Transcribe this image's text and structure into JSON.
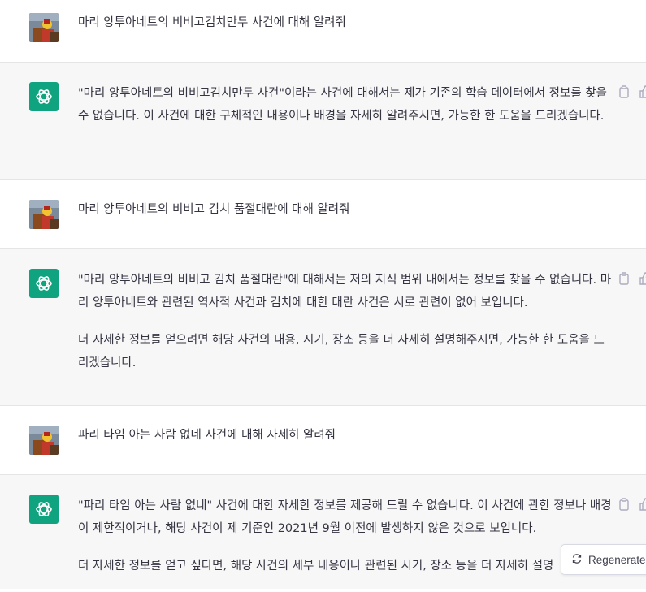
{
  "conversation": [
    {
      "role": "user",
      "text": "마리 앙투아네트의 비비고김치만두 사건에 대해 알려줘"
    },
    {
      "role": "assistant",
      "paragraphs": [
        "\"마리 앙투아네트의 비비고김치만두 사건\"이라는 사건에 대해서는 제가 기존의 학습 데이터에서 정보를 찾을 수 없습니다. 이 사건에 대한 구체적인 내용이나 배경을 자세히 알려주시면, 가능한 한 도움을 드리겠습니다."
      ]
    },
    {
      "role": "user",
      "text": "마리 앙투아네트의 비비고 김치 품절대란에 대해 알려줘"
    },
    {
      "role": "assistant",
      "paragraphs": [
        "\"마리 앙투아네트의 비비고 김치 품절대란\"에 대해서는 저의 지식 범위 내에서는 정보를 찾을 수 없습니다. 마리 앙투아네트와 관련된 역사적 사건과 김치에 대한 대란 사건은 서로 관련이 없어 보입니다.",
        "더 자세한 정보를 얻으려면 해당 사건의 내용, 시기, 장소 등을 더 자세히 설명해주시면, 가능한 한 도움을 드리겠습니다."
      ]
    },
    {
      "role": "user",
      "text": "파리 타임 아는 사람 없네 사건에 대해 자세히 알려줘"
    },
    {
      "role": "assistant",
      "paragraphs": [
        "\"파리 타임 아는 사람 없네\" 사건에 대한 자세한 정보를 제공해 드릴 수 없습니다. 이 사건에 관한 정보나 배경이 제한적이거나, 해당 사건이 제 기준인 2021년 9월 이전에 발생하지 않은 것으로 보입니다.",
        "더 자세한 정보를 얻고 싶다면, 해당 사건의 세부 내용이나 관련된 시기, 장소 등을 더 자세히 설명"
      ]
    }
  ],
  "regenerate_label": "Regenerate",
  "colors": {
    "assistant_bg": "#f7f7f8",
    "brand": "#10a37f",
    "text": "#343541"
  }
}
